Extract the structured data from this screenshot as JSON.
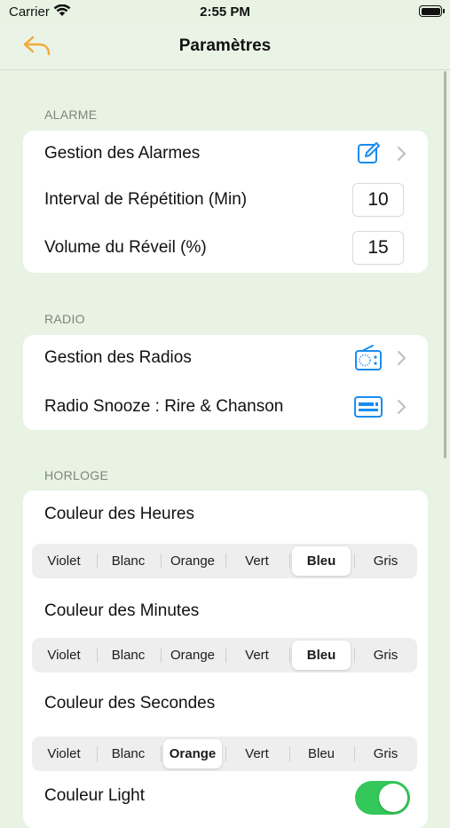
{
  "status_bar": {
    "carrier": "Carrier",
    "time": "2:55 PM"
  },
  "nav": {
    "title": "Paramètres",
    "back_icon": "arrow-uturn-left-icon",
    "accent_color": "#f2a93b"
  },
  "alarme": {
    "header": "ALARME",
    "manage_label": "Gestion des Alarmes",
    "snooze_interval_label": "Interval de Répétition (Min)",
    "snooze_interval_value": "10",
    "volume_label": "Volume du Réveil (%)",
    "volume_value": "15"
  },
  "radio": {
    "header": "RADIO",
    "manage_label": "Gestion des Radios",
    "snooze_label": "Radio Snooze : Rire & Chanson"
  },
  "horloge": {
    "header": "HORLOGE",
    "hours_label": "Couleur des Heures",
    "minutes_label": "Couleur des Minutes",
    "seconds_label": "Couleur des Secondes",
    "light_label": "Couleur Light",
    "light_enabled": true,
    "color_options": [
      "Violet",
      "Blanc",
      "Orange",
      "Vert",
      "Bleu",
      "Gris"
    ],
    "hours_selected": "Bleu",
    "minutes_selected": "Bleu",
    "seconds_selected": "Orange"
  },
  "colors": {
    "accent_blue": "#1a8cf0",
    "toggle_green": "#34c759",
    "background": "#e8f3e3"
  }
}
